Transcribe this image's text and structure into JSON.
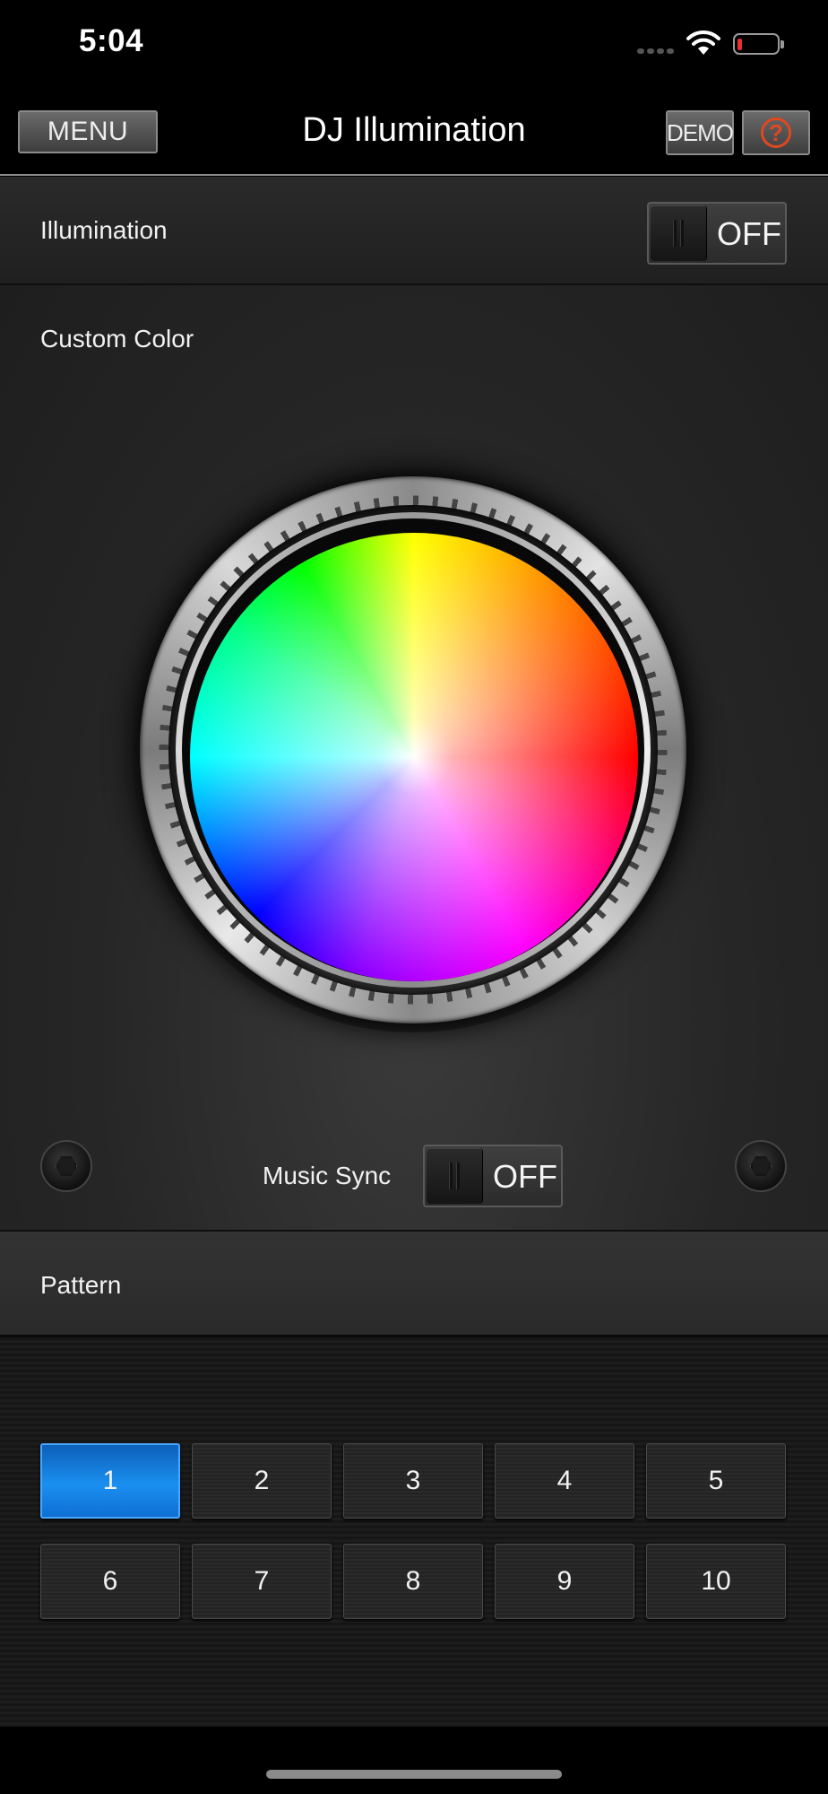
{
  "status_bar": {
    "time": "5:04"
  },
  "nav": {
    "menu_label": "MENU",
    "title": "DJ Illumination",
    "demo_label": "DEMO",
    "help_label": "?"
  },
  "illumination": {
    "label": "Illumination",
    "toggle_state": "OFF"
  },
  "custom_color": {
    "label": "Custom Color"
  },
  "music_sync": {
    "label": "Music Sync",
    "toggle_state": "OFF"
  },
  "pattern": {
    "label": "Pattern",
    "selected": "1",
    "pads": [
      "1",
      "2",
      "3",
      "4",
      "5",
      "6",
      "7",
      "8",
      "9",
      "10"
    ]
  },
  "colors": {
    "active_pad": "#1a8ff0",
    "help_icon": "#e0481f",
    "battery_low": "#e83030"
  }
}
